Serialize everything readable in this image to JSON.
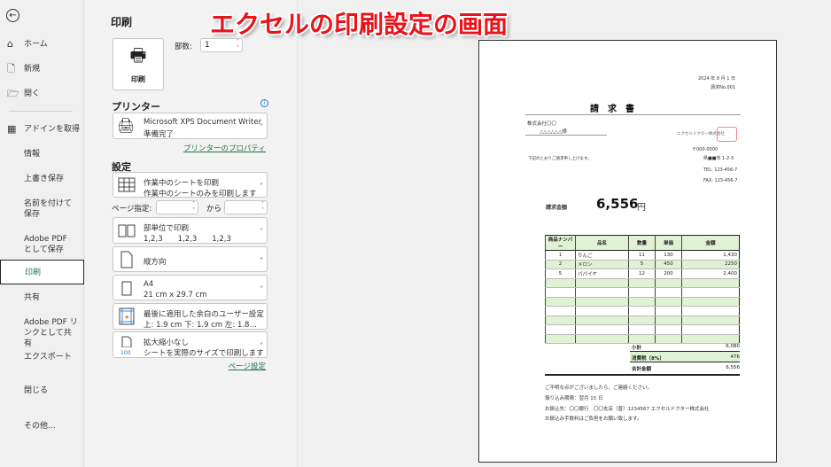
{
  "overlay_title": "エクセルの印刷設定の画面",
  "sidebar": {
    "items": [
      {
        "label": "ホーム",
        "icon": "home-icon"
      },
      {
        "label": "新規",
        "icon": "new-file-icon"
      },
      {
        "label": "開く",
        "icon": "folder-open-icon"
      },
      {
        "label": "アドインを取得",
        "icon": "addin-icon"
      },
      {
        "label": "情報"
      },
      {
        "label": "上書き保存"
      },
      {
        "label": "名前を付けて保存"
      },
      {
        "label": "Adobe PDF として保存"
      },
      {
        "label": "印刷"
      },
      {
        "label": "共有"
      },
      {
        "label": "Adobe PDF リンクとして共有"
      },
      {
        "label": "エクスポート"
      },
      {
        "label": "閉じる"
      },
      {
        "label": "その他..."
      }
    ]
  },
  "print": {
    "heading": "印刷",
    "button": "印刷",
    "copies_label": "部数:",
    "copies_value": "1"
  },
  "printer": {
    "heading": "プリンター",
    "name": "Microsoft XPS Document Writer",
    "status": "準備完了",
    "properties_link": "プリンターのプロパティ"
  },
  "settings": {
    "heading": "設定",
    "what": {
      "t1": "作業中のシートを印刷",
      "t2": "作業中のシートのみを印刷します"
    },
    "pages_label": "ページ指定:",
    "pages_to": "から",
    "collate": {
      "t1": "部単位で印刷",
      "t2": "1,2,3　　1,2,3　　1,2,3"
    },
    "orientation": {
      "t1": "縦方向"
    },
    "paper": {
      "t1": "A4",
      "t2": "21 cm x 29.7 cm"
    },
    "margins": {
      "t1": "最後に適用した余白のユーザー設定",
      "t2": "上: 1.9 cm 下: 1.9 cm 左: 1.8…"
    },
    "scaling": {
      "t1": "拡大縮小なし",
      "t2": "シートを実際のサイズで印刷します",
      "icon_text": "100"
    },
    "page_setup_link": "ページ設定"
  },
  "invoice": {
    "date": "2024 年 8 月 1 日",
    "number": "請求No.001",
    "title": "請　求　書",
    "client": "株式会社〇〇",
    "client_person": "△△△△△△様",
    "company": "エクセルドクター株式会社",
    "postal": "〒000-0000",
    "address": "県■■市 1-2-3",
    "tel": "TEL: 123-456-7",
    "fax": "FAX: 123-456-7",
    "intro": "下記のとおりご請求申し上げます。",
    "amount_label": "請求金額",
    "amount": "6,556",
    "yen": "円",
    "headers": [
      "商品ナンバー",
      "品名",
      "数量",
      "単価",
      "金額"
    ],
    "rows": [
      [
        "1",
        "りんご",
        "11",
        "130",
        "1,430"
      ],
      [
        "2",
        "メロン",
        "5",
        "450",
        "2250"
      ],
      [
        "5",
        "パパイヤ",
        "12",
        "200",
        "2,400"
      ]
    ],
    "subtotal_label": "小計",
    "subtotal": "6,080",
    "tax_label": "消費税（8%）",
    "tax": "476",
    "total_label": "合計金額",
    "total": "6,556",
    "notes": [
      "ご不明な点がございましたら、ご連絡ください。",
      "振り込み期限：翌月 15 日",
      "お振込先：〇〇銀行　〇〇支店（普）1234567 エクセルドクター株式会社",
      "お振込み手数料はご負担をお願い致します。"
    ]
  }
}
